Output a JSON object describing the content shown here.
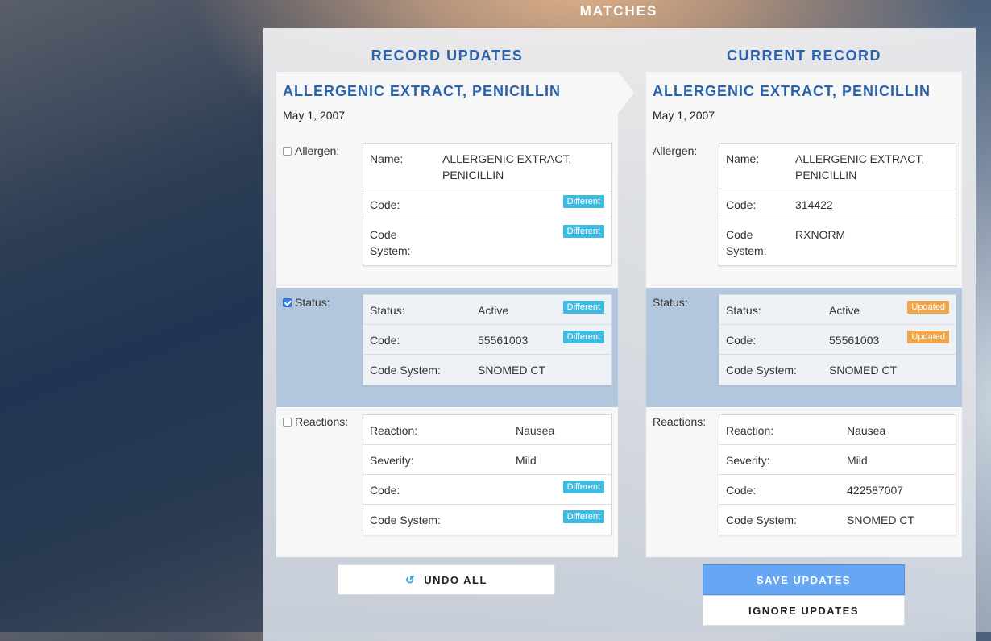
{
  "header": {
    "title": "MATCHES"
  },
  "left": {
    "heading": "RECORD UPDATES",
    "title": "ALLERGENIC EXTRACT, PENICILLIN",
    "date": "May 1, 2007",
    "sections": {
      "allergen": {
        "label": "Allergen:",
        "checked": false,
        "rows": [
          {
            "label": "Name:",
            "value": "ALLERGENIC EXTRACT, PENICILLIN",
            "badge": ""
          },
          {
            "label": "Code:",
            "value": "",
            "badge": "Different"
          },
          {
            "label": "Code System:",
            "value": "",
            "badge": "Different"
          }
        ]
      },
      "status": {
        "label": "Status:",
        "checked": true,
        "rows": [
          {
            "label": "Status:",
            "value": "Active",
            "badge": "Different"
          },
          {
            "label": "Code:",
            "value": "55561003",
            "badge": "Different"
          },
          {
            "label": "Code System:",
            "value": "SNOMED CT",
            "badge": ""
          }
        ]
      },
      "reactions": {
        "label": "Reactions:",
        "checked": false,
        "rows": [
          {
            "label": "Reaction:",
            "value": "Nausea",
            "badge": ""
          },
          {
            "label": "Severity:",
            "value": "Mild",
            "badge": ""
          },
          {
            "label": "Code:",
            "value": "",
            "badge": "Different"
          },
          {
            "label": "Code System:",
            "value": "",
            "badge": "Different"
          }
        ]
      }
    }
  },
  "right": {
    "heading": "CURRENT RECORD",
    "title": "ALLERGENIC EXTRACT, PENICILLIN",
    "date": "May 1, 2007",
    "sections": {
      "allergen": {
        "label": "Allergen:",
        "rows": [
          {
            "label": "Name:",
            "value": "ALLERGENIC EXTRACT, PENICILLIN",
            "badge": ""
          },
          {
            "label": "Code:",
            "value": "314422",
            "badge": ""
          },
          {
            "label": "Code System:",
            "value": "RXNORM",
            "badge": ""
          }
        ]
      },
      "status": {
        "label": "Status:",
        "rows": [
          {
            "label": "Status:",
            "value": "Active",
            "badge": "Updated"
          },
          {
            "label": "Code:",
            "value": "55561003",
            "badge": "Updated"
          },
          {
            "label": "Code System:",
            "value": "SNOMED CT",
            "badge": ""
          }
        ]
      },
      "reactions": {
        "label": "Reactions:",
        "rows": [
          {
            "label": "Reaction:",
            "value": "Nausea",
            "badge": ""
          },
          {
            "label": "Severity:",
            "value": "Mild",
            "badge": ""
          },
          {
            "label": "Code:",
            "value": "422587007",
            "badge": ""
          },
          {
            "label": "Code System:",
            "value": "SNOMED CT",
            "badge": ""
          }
        ]
      }
    }
  },
  "actions": {
    "undo_label": "UNDO ALL",
    "undo_icon": "undo-icon",
    "save_label": "SAVE UPDATES",
    "ignore_label": "IGNORE UPDATES"
  },
  "colors": {
    "accent": "#2a63ad",
    "different_badge": "#3dbbe0",
    "updated_badge": "#f0a64a",
    "highlight_band": "#b2c6de",
    "save_button": "#67a6f3"
  }
}
